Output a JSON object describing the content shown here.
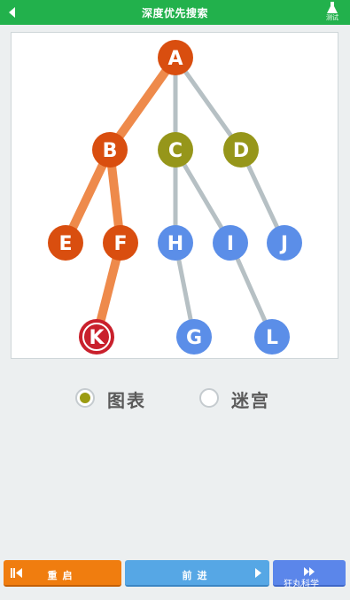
{
  "header": {
    "title": "深度优先搜索",
    "test_label": "测试"
  },
  "graph": {
    "nodes": [
      {
        "id": "A",
        "color": "#d94e0f"
      },
      {
        "id": "B",
        "color": "#d94e0f"
      },
      {
        "id": "C",
        "color": "#96961a"
      },
      {
        "id": "D",
        "color": "#96961a"
      },
      {
        "id": "E",
        "color": "#d94e0f"
      },
      {
        "id": "F",
        "color": "#d94e0f"
      },
      {
        "id": "H",
        "color": "#5b8ee8"
      },
      {
        "id": "I",
        "color": "#5b8ee8"
      },
      {
        "id": "J",
        "color": "#5b8ee8"
      },
      {
        "id": "K",
        "color": "#c9202c",
        "current": true
      },
      {
        "id": "G",
        "color": "#5b8ee8"
      },
      {
        "id": "L",
        "color": "#5b8ee8"
      }
    ],
    "edges": [
      {
        "from": "A",
        "to": "B",
        "visited": true
      },
      {
        "from": "A",
        "to": "C",
        "visited": false
      },
      {
        "from": "A",
        "to": "D",
        "visited": false
      },
      {
        "from": "B",
        "to": "E",
        "visited": true
      },
      {
        "from": "B",
        "to": "F",
        "visited": true
      },
      {
        "from": "C",
        "to": "H",
        "visited": false
      },
      {
        "from": "C",
        "to": "I",
        "visited": false
      },
      {
        "from": "D",
        "to": "J",
        "visited": false
      },
      {
        "from": "F",
        "to": "K",
        "visited": true
      },
      {
        "from": "H",
        "to": "G",
        "visited": false
      },
      {
        "from": "I",
        "to": "L",
        "visited": false
      }
    ],
    "visited_edge_color": "#ee8a4b",
    "unvisited_edge_color": "#b6c0c4"
  },
  "mode": {
    "options": [
      {
        "label": "图表",
        "selected": true
      },
      {
        "label": "迷宫",
        "selected": false
      }
    ]
  },
  "controls": {
    "reset_label": "重启",
    "next_label": "前进",
    "fast_forward_icon": "fast-forward-icon"
  },
  "watermark": "狂丸科学"
}
